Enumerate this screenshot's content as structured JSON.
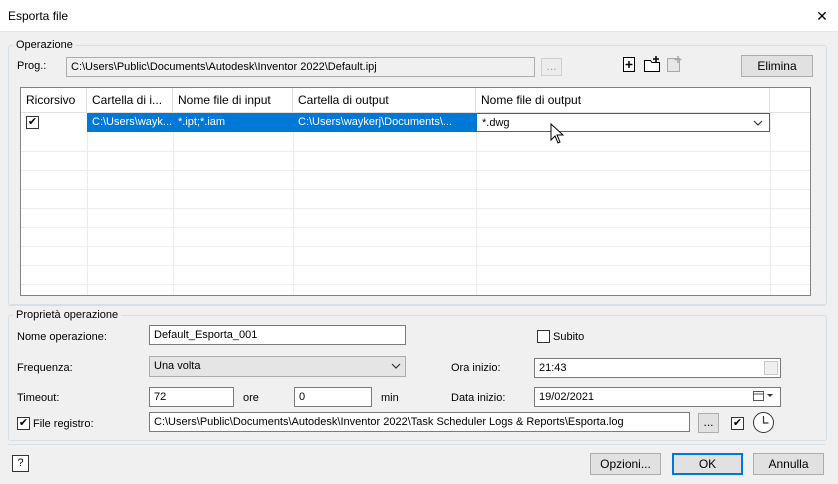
{
  "window": {
    "title": "Esporta file",
    "close_glyph": "✕"
  },
  "operazione": {
    "legend": "Operazione",
    "prog_label": "Prog.:",
    "prog_value": "C:\\Users\\Public\\Documents\\Autodesk\\Inventor 2022\\Default.ipj",
    "browse_label": "...",
    "delete_label": "Elimina",
    "icons": [
      "add-operation-icon",
      "add-folder-icon",
      "copy-operation-icon"
    ]
  },
  "table": {
    "columns": [
      "Ricorsivo",
      "Cartella di i...",
      "Nome file di input",
      "Cartella di output",
      "Nome file di output"
    ],
    "rows": [
      {
        "recursive_check": "✔",
        "input_folder": "C:\\Users\\wayk...",
        "input_names": "*.ipt;*.iam",
        "output_folder": "C:\\Users\\waykerj\\Documents\\...",
        "output_name": "*.dwg"
      }
    ],
    "dropdown_arrow": "⌵"
  },
  "proprieta": {
    "legend": "Proprietà operazione",
    "name_label": "Nome operazione:",
    "name_value": "Default_Esporta_001",
    "subito_label": "Subito",
    "freq_label": "Frequenza:",
    "freq_value": "Una volta",
    "ora_label": "Ora inizio:",
    "ora_value": "21:43",
    "timeout_label": "Timeout:",
    "timeout_value": "72",
    "ore_label": "ore",
    "min_value": "0",
    "min_label": "min",
    "data_label": "Data inizio:",
    "data_value": "19/02/2021",
    "log_check": "✔",
    "log_label": "File registro:",
    "log_value": "C:\\Users\\Public\\Documents\\Autodesk\\Inventor 2022\\Task Scheduler Logs & Reports\\Esporta.log",
    "log_browse": "...",
    "log_enable_check": "✔"
  },
  "footer": {
    "help_glyph": "?",
    "options_label": "Opzioni...",
    "ok_label": "OK",
    "cancel_label": "Annulla"
  },
  "colors": {
    "selection": "#0078d7",
    "default_button_border": "#0078d7"
  }
}
